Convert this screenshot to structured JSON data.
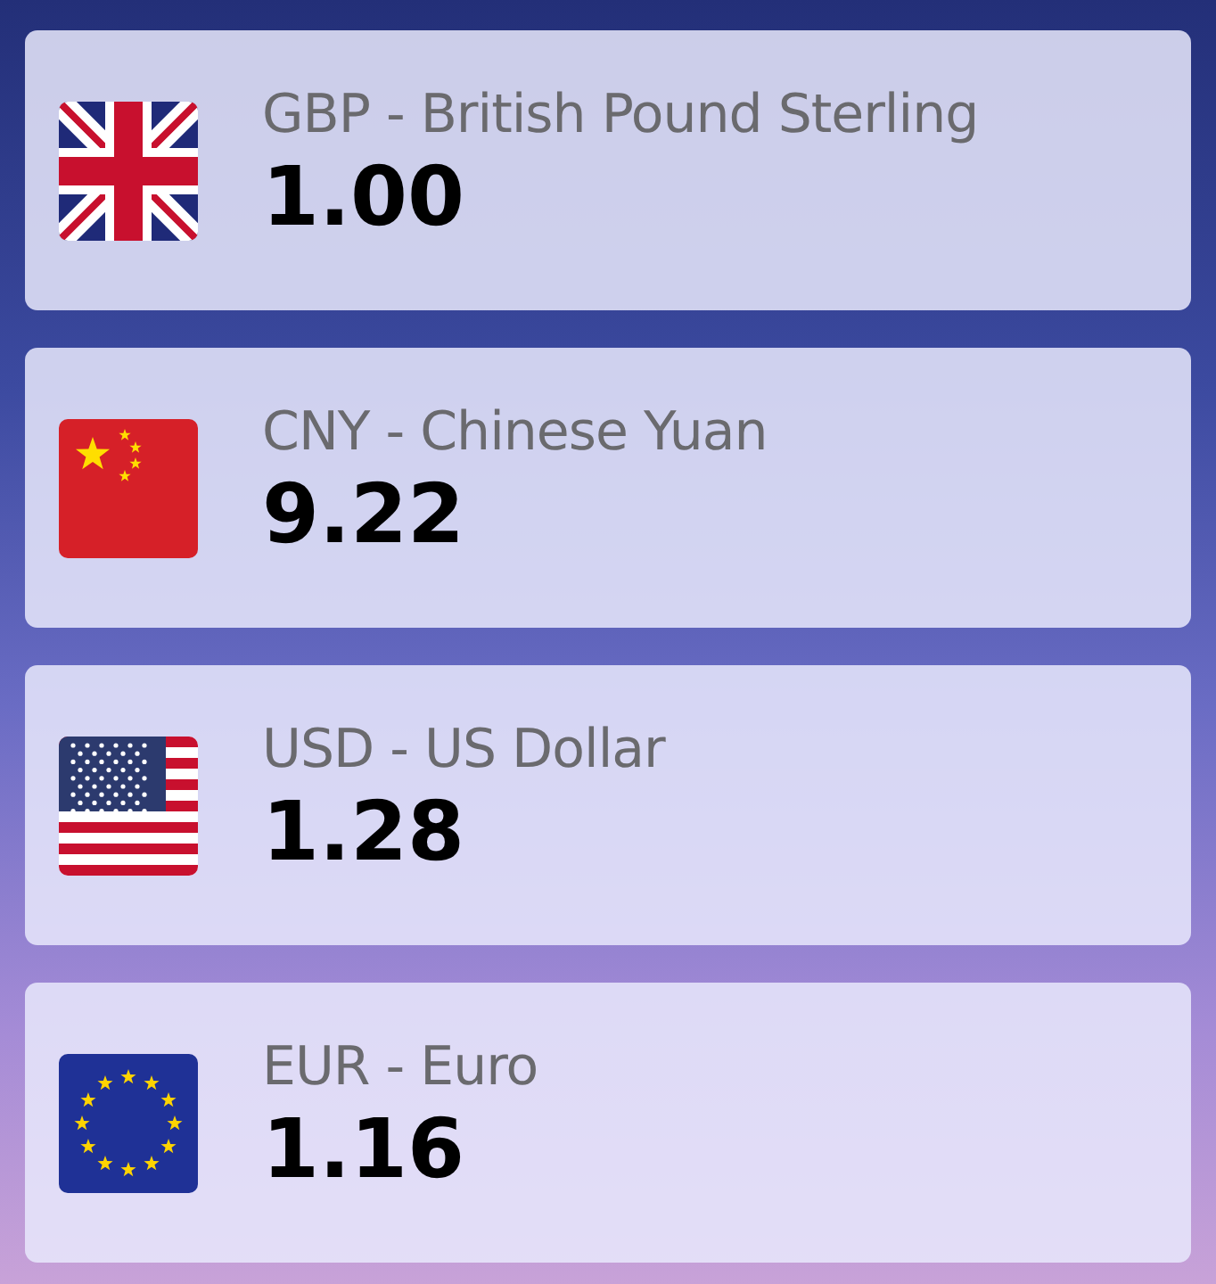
{
  "currencies": [
    {
      "kind": "gb",
      "name": "GBP - British Pound Sterling",
      "value": "1.00"
    },
    {
      "kind": "cn",
      "name": "CNY - Chinese Yuan",
      "value": "9.22"
    },
    {
      "kind": "us",
      "name": "USD - US Dollar",
      "value": "1.28"
    },
    {
      "kind": "eu",
      "name": "EUR - Euro",
      "value": "1.16"
    }
  ]
}
